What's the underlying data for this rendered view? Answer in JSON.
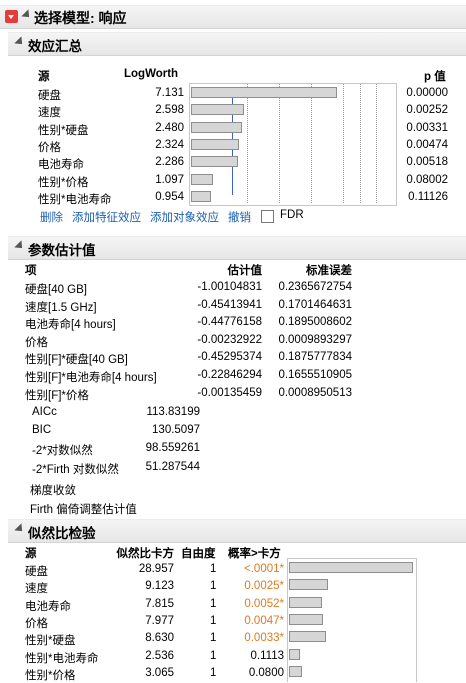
{
  "title": "选择模型: 响应",
  "effect_summary": {
    "title": "效应汇总",
    "col_source": "源",
    "col_logworth": "LogWorth",
    "col_p": "p 值",
    "rows": [
      {
        "source": "硬盘",
        "logworth": "7.131",
        "lw": 7.131,
        "p": "0.00000"
      },
      {
        "source": "速度",
        "logworth": "2.598",
        "lw": 2.598,
        "p": "0.00252"
      },
      {
        "source": "性别*硬盘",
        "logworth": "2.480",
        "lw": 2.48,
        "p": "0.00331"
      },
      {
        "source": "价格",
        "logworth": "2.324",
        "lw": 2.324,
        "p": "0.00474"
      },
      {
        "source": "电池寿命",
        "logworth": "2.286",
        "lw": 2.286,
        "p": "0.00518"
      },
      {
        "source": "性别*价格",
        "logworth": "1.097",
        "lw": 1.097,
        "p": "0.08002"
      },
      {
        "source": "性别*电池寿命",
        "logworth": "0.954",
        "lw": 0.954,
        "p": "0.11126"
      }
    ],
    "actions": {
      "remove": "删除",
      "add_feature": "添加特征效应",
      "add_object": "添加对象效应",
      "undo": "撤销",
      "fdr": "FDR"
    }
  },
  "param_estimates": {
    "title": "参数估计值",
    "col_term": "项",
    "col_est": "估计值",
    "col_se": "标准误差",
    "rows": [
      {
        "term": "硬盘[40 GB]",
        "est": "-1.00104831",
        "se": "0.2365672754"
      },
      {
        "term": "速度[1.5 GHz]",
        "est": "-0.45413941",
        "se": "0.1701464631"
      },
      {
        "term": "电池寿命[4 hours]",
        "est": "-0.44776158",
        "se": "0.1895008602"
      },
      {
        "term": "价格",
        "est": "-0.00232922",
        "se": "0.0009893297"
      },
      {
        "term": "性别[F]*硬盘[40 GB]",
        "est": "-0.45295374",
        "se": "0.1875777834"
      },
      {
        "term": "性别[F]*电池寿命[4 hours]",
        "est": "-0.22846294",
        "se": "0.1655510905"
      },
      {
        "term": "性别[F]*价格",
        "est": "-0.00135459",
        "se": "0.0008950513"
      }
    ],
    "stats": [
      {
        "label": "AICc",
        "value": "113.83199"
      },
      {
        "label": "BIC",
        "value": "130.5097"
      },
      {
        "label": "-2*对数似然",
        "value": "98.559261"
      },
      {
        "label": "-2*Firth 对数似然",
        "value": "51.287544"
      }
    ],
    "note1": "梯度收敛",
    "note2": "Firth 偏倚调整估计值"
  },
  "lr_test": {
    "title": "似然比检验",
    "col_source": "源",
    "col_chisq": "似然比卡方",
    "col_df": "自由度",
    "col_prob": "概率>卡方",
    "rows": [
      {
        "source": "硬盘",
        "chisq": "28.957",
        "x2": 28.957,
        "df": "1",
        "prob": "<.0001*",
        "sig": true
      },
      {
        "source": "速度",
        "chisq": "9.123",
        "x2": 9.123,
        "df": "1",
        "prob": "0.0025*",
        "sig": true
      },
      {
        "source": "电池寿命",
        "chisq": "7.815",
        "x2": 7.815,
        "df": "1",
        "prob": "0.0052*",
        "sig": true
      },
      {
        "source": "价格",
        "chisq": "7.977",
        "x2": 7.977,
        "df": "1",
        "prob": "0.0047*",
        "sig": true
      },
      {
        "source": "性别*硬盘",
        "chisq": "8.630",
        "x2": 8.63,
        "df": "1",
        "prob": "0.0033*",
        "sig": true
      },
      {
        "source": "性别*电池寿命",
        "chisq": "2.536",
        "x2": 2.536,
        "df": "1",
        "prob": "0.1113",
        "sig": false
      },
      {
        "source": "性别*价格",
        "chisq": "3.065",
        "x2": 3.065,
        "df": "1",
        "prob": "0.0800",
        "sig": false
      }
    ]
  },
  "colors": {
    "accent_link": "#1a5fb4",
    "significant": "#e07a1f",
    "menu_red": "#e63b3b",
    "ref_line": "#3a63c9"
  }
}
